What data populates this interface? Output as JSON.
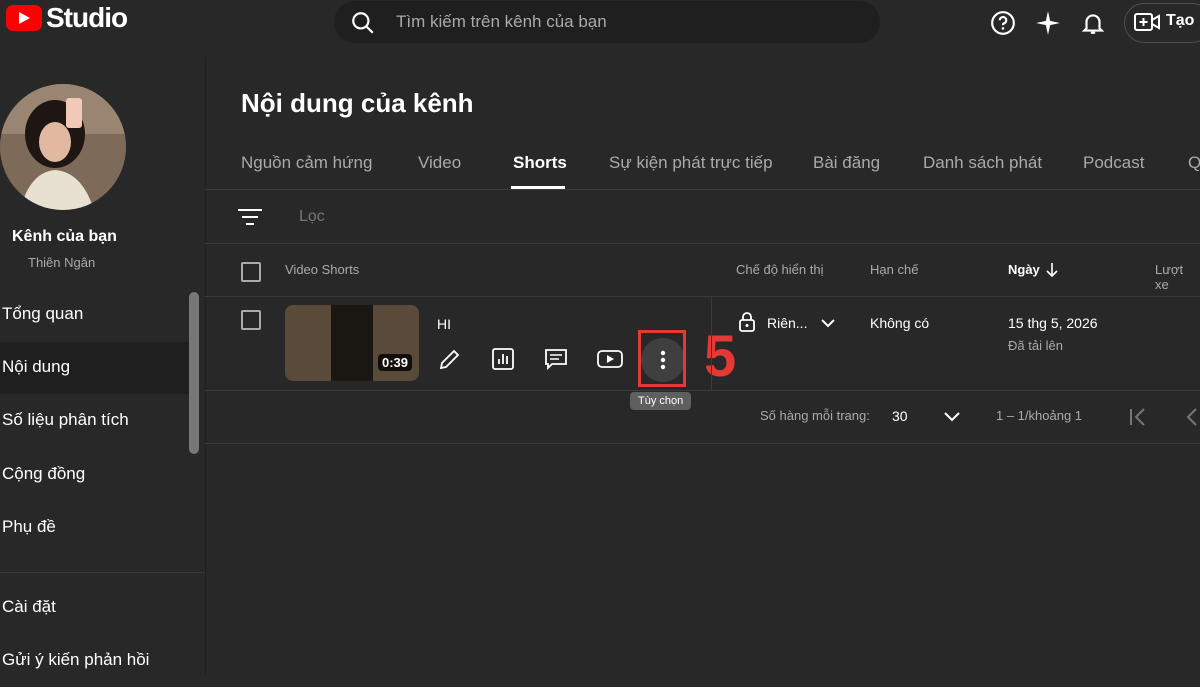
{
  "header": {
    "logo_text": "Studio",
    "search_placeholder": "Tìm kiếm trên kênh của bạn",
    "create_label": "Tạo",
    "icons": [
      "help-icon",
      "sparkle-icon",
      "bell-icon",
      "video-create-icon"
    ]
  },
  "sidebar": {
    "channel_title": "Kênh của bạn",
    "channel_name": "Thiên Ngân",
    "items": [
      {
        "label": "Tổng quan"
      },
      {
        "label": "Nội dung"
      },
      {
        "label": "Số liệu phân tích"
      },
      {
        "label": "Cộng đồng"
      },
      {
        "label": "Phụ đề"
      },
      {
        "label": "Cài đặt"
      },
      {
        "label": "Gửi ý kiến phản hồi"
      }
    ],
    "active_index": 1
  },
  "main": {
    "title": "Nội dung của kênh",
    "tabs": [
      {
        "label": "Nguồn cảm hứng"
      },
      {
        "label": "Video"
      },
      {
        "label": "Shorts"
      },
      {
        "label": "Sự kiện phát trực tiếp"
      },
      {
        "label": "Bài đăng"
      },
      {
        "label": "Danh sách phát"
      },
      {
        "label": "Podcast"
      },
      {
        "label": "Q"
      }
    ],
    "active_tab": "Shorts",
    "filter_label": "Lọc",
    "columns": {
      "video": "Video Shorts",
      "visibility": "Chế độ hiển thị",
      "restrictions": "Hạn chế",
      "date": "Ngày",
      "views": "Lượt xe"
    },
    "rows": [
      {
        "duration": "0:39",
        "title": "HI",
        "visibility": "Riên...",
        "restrictions": "Không có",
        "date": "15 thg 5, 2026",
        "date_status": "Đã tải lên"
      }
    ],
    "options_tooltip": "Tùy chọn",
    "step_number": "5",
    "footer": {
      "rows_per_page_label": "Số hàng mỗi trang:",
      "rows_per_page_value": "30",
      "range": "1 – 1/khoảng 1"
    }
  },
  "colors": {
    "background": "#282828",
    "accent_red": "#e53935",
    "brand_red": "#ff0000",
    "muted_text": "#aaaaaa"
  }
}
